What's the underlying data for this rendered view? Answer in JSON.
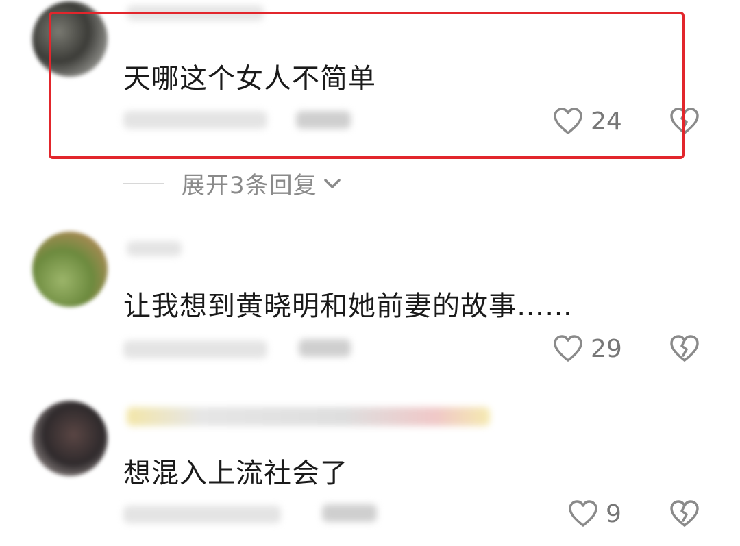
{
  "comments": [
    {
      "text": "天哪这个女人不简单",
      "likes": "24"
    },
    {
      "text": "让我想到黄晓明和她前妻的故事……",
      "likes": "29"
    },
    {
      "text": "想混入上流社会了",
      "likes": "9"
    }
  ],
  "expand_replies": {
    "label": "展开3条回复"
  },
  "colors": {
    "highlight_border": "#e2262c",
    "icon": "#8a8a8a"
  }
}
